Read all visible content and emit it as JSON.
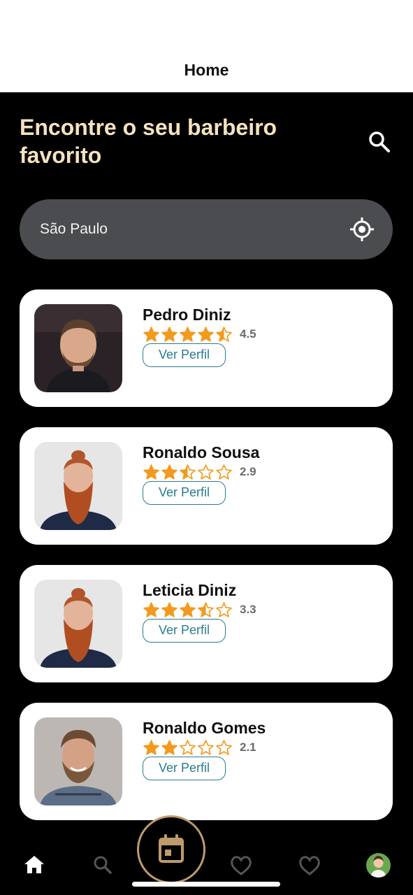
{
  "header": {
    "title": "Home"
  },
  "hero": {
    "headline": "Encontre o seu barbeiro favorito"
  },
  "location": {
    "value": "São Paulo"
  },
  "barbers": [
    {
      "name": "Pedro Diniz",
      "rating": "4.5",
      "rating_value": 4.5,
      "button_label": "Ver Perfil"
    },
    {
      "name": "Ronaldo Sousa",
      "rating": "2.9",
      "rating_value": 2.9,
      "button_label": "Ver Perfil"
    },
    {
      "name": "Leticia Diniz",
      "rating": "3.3",
      "rating_value": 3.3,
      "button_label": "Ver Perfil"
    },
    {
      "name": "Ronaldo Gomes",
      "rating": "2.1",
      "rating_value": 2.1,
      "button_label": "Ver Perfil"
    }
  ],
  "colors": {
    "background": "#000000",
    "headline": "#F3E2BE",
    "star": "#F29A1D",
    "button_border": "#2A7C8E",
    "fab_ring": "#BE9B6C",
    "location_field": "#4A4C4F"
  },
  "nav": {
    "items": [
      "home-icon",
      "search-icon",
      "calendar-icon",
      "heart-icon",
      "heart-icon",
      "profile-avatar"
    ],
    "active": "home-icon"
  }
}
